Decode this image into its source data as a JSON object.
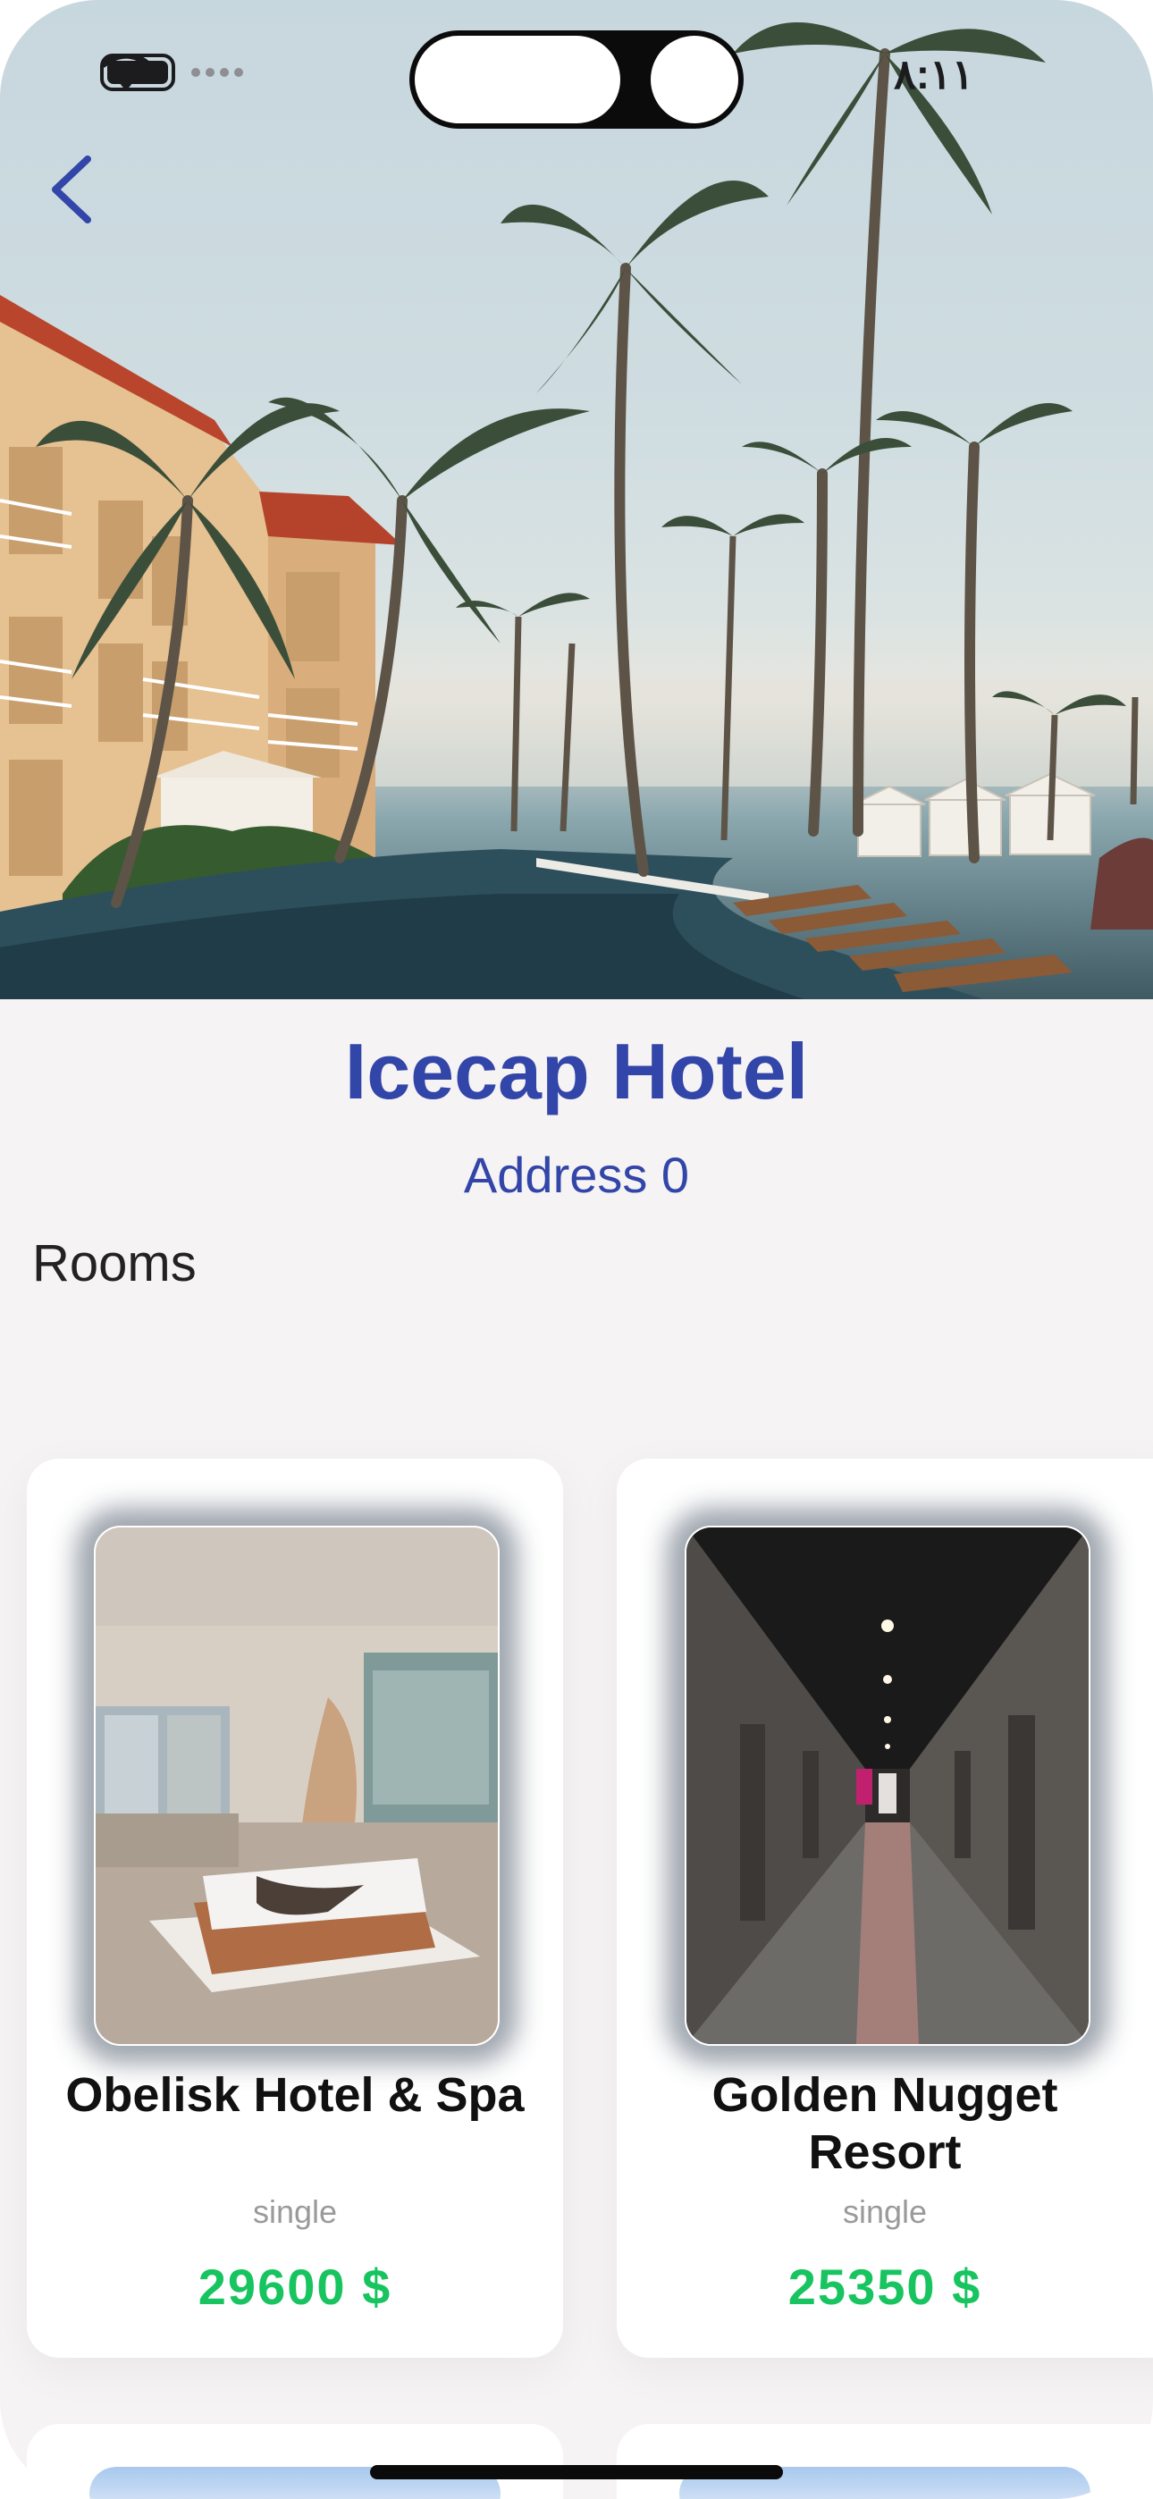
{
  "status_bar": {
    "time": "٨:١١",
    "battery_icon": "battery-full-icon",
    "wifi_icon": "wifi-icon",
    "signal_icon": "cellular-signal-icon"
  },
  "nav": {
    "back_icon": "chevron-left-icon"
  },
  "hotel": {
    "name": "Icecap Hotel",
    "address": "Address 0"
  },
  "rooms_section": {
    "title": "Rooms",
    "rooms": [
      {
        "name": "Obelisk Hotel & Spa",
        "type": "single",
        "price": "29600  $"
      },
      {
        "name": "Golden Nugget Resort",
        "type": "single",
        "price": "25350  $"
      }
    ]
  },
  "colors": {
    "accent": "#3245a8",
    "price": "#17c45f",
    "background": "#f6f3f4",
    "muted_text": "#9a9a9a"
  }
}
